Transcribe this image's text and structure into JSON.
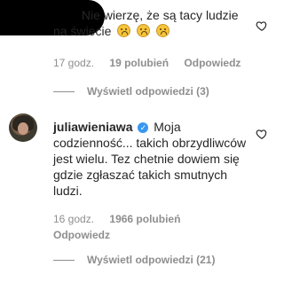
{
  "comment1": {
    "text_prefix": "Nie wierzę, że są tacy ludzie na świecie",
    "emojis": [
      "sad-emoji",
      "sad-emoji",
      "sad-emoji"
    ],
    "time": "17 godz.",
    "likes": "19 polubień",
    "reply": "Odpowiedz",
    "view_replies": "Wyświetl odpowiedzi (3)"
  },
  "comment2": {
    "username": "juliawieniawa",
    "text": "Moja codzienność... takich obrzydliwców jest wielu. Tez chetnie dowiem się gdzie zgłaszać takich smutnych ludzi.",
    "time": "16 godz.",
    "likes": "1966 polubień",
    "reply": "Odpowiedz",
    "view_replies": "Wyświetl odpowiedzi (21)"
  },
  "colors": {
    "text": "#262626",
    "meta": "#8e8e8e",
    "verified": "#3897f0"
  }
}
